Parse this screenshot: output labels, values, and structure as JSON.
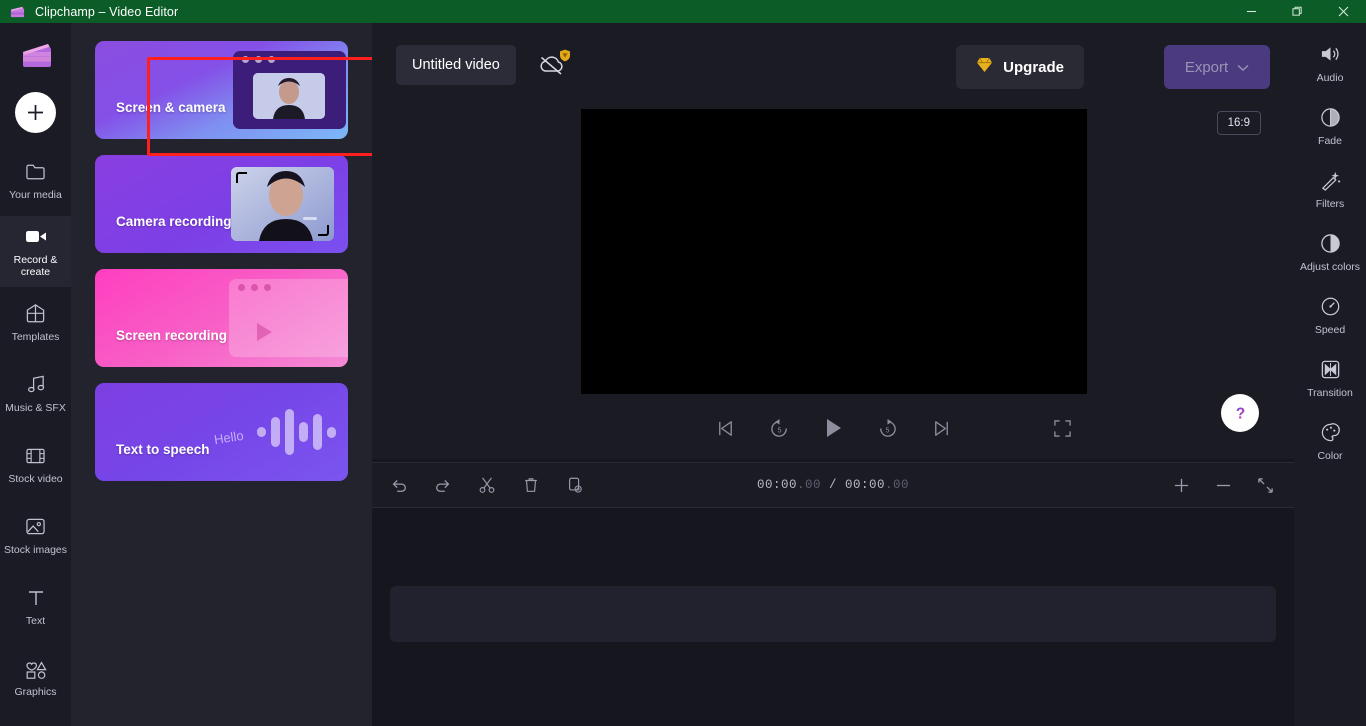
{
  "window": {
    "app_title": "Clipchamp – Video Editor",
    "logo_icon": "clapperboard-icon",
    "controls": [
      {
        "name": "minimize",
        "icon": "minimize-icon"
      },
      {
        "name": "maximize",
        "icon": "restore-icon"
      },
      {
        "name": "close",
        "icon": "close-icon"
      }
    ],
    "titlebar_color": "#0b5c26"
  },
  "left_rail": {
    "logo_icon": "clipchamp-logo-icon",
    "add_button": {
      "icon": "plus-icon",
      "label": "+"
    },
    "items": [
      {
        "label": "Your media",
        "icon": "folder-icon",
        "active": false
      },
      {
        "label": "Record & create",
        "icon": "video-camera-icon",
        "active": true
      },
      {
        "label": "Templates",
        "icon": "templates-icon",
        "active": false
      },
      {
        "label": "Music & SFX",
        "icon": "music-note-icon",
        "active": false
      },
      {
        "label": "Stock video",
        "icon": "film-strip-icon",
        "active": false
      },
      {
        "label": "Stock images",
        "icon": "image-icon",
        "active": false
      },
      {
        "label": "Text",
        "icon": "text-icon",
        "active": false
      },
      {
        "label": "Graphics",
        "icon": "shapes-icon",
        "active": false
      }
    ]
  },
  "panel": {
    "cards": [
      {
        "label": "Screen & camera",
        "highlighted": true,
        "art": "window-with-pip"
      },
      {
        "label": "Camera recording",
        "highlighted": false,
        "art": "person-portrait"
      },
      {
        "label": "Screen recording",
        "highlighted": false,
        "art": "window-with-play"
      },
      {
        "label": "Text to speech",
        "highlighted": false,
        "art": "waveform",
        "art_text": "Hello"
      }
    ],
    "highlight_color": "#ff1f1f",
    "collapse_handle_icon": "chevron-left-icon"
  },
  "header": {
    "project_title": "Untitled video",
    "sync_icon": "cloud-off-icon",
    "sync_badge_icon": "diamond-shield-icon",
    "upgrade": {
      "label": "Upgrade",
      "icon": "diamond-icon"
    },
    "export": {
      "label": "Export",
      "icon": "chevron-down-icon",
      "disabled": true
    }
  },
  "preview": {
    "aspect_ratio": "16:9",
    "canvas_color": "#000000",
    "help_button": {
      "icon": "question-mark-icon",
      "label": "?"
    },
    "collapse_handle_icon": "chevron-left-icon",
    "controls": [
      {
        "name": "skip-to-start",
        "icon": "skip-back-icon"
      },
      {
        "name": "rewind-5-seconds",
        "icon": "rewind-5-icon",
        "label": "5"
      },
      {
        "name": "play",
        "icon": "play-icon"
      },
      {
        "name": "forward-5-seconds",
        "icon": "forward-5-icon",
        "label": "5"
      },
      {
        "name": "skip-to-end",
        "icon": "skip-forward-icon"
      }
    ],
    "fullscreen": {
      "name": "fullscreen",
      "icon": "fullscreen-icon"
    }
  },
  "right_rail": {
    "items": [
      {
        "label": "Audio",
        "icon": "speaker-icon"
      },
      {
        "label": "Fade",
        "icon": "fade-icon"
      },
      {
        "label": "Filters",
        "icon": "magic-wand-icon"
      },
      {
        "label": "Adjust colors",
        "icon": "contrast-icon"
      },
      {
        "label": "Speed",
        "icon": "speedometer-icon"
      },
      {
        "label": "Transition",
        "icon": "transition-icon"
      },
      {
        "label": "Color",
        "icon": "palette-icon"
      }
    ]
  },
  "timeline": {
    "tools": [
      {
        "name": "undo",
        "icon": "undo-icon"
      },
      {
        "name": "redo",
        "icon": "redo-icon"
      },
      {
        "name": "split",
        "icon": "scissors-icon"
      },
      {
        "name": "delete",
        "icon": "trash-icon"
      },
      {
        "name": "duplicate",
        "icon": "duplicate-icon"
      }
    ],
    "timecode_current": "00:00",
    "timecode_current_frac": ".00",
    "timecode_separator": " / ",
    "timecode_total": "00:00",
    "timecode_total_frac": ".00",
    "zoom_controls": [
      {
        "name": "zoom-in",
        "icon": "plus-icon"
      },
      {
        "name": "zoom-out",
        "icon": "minus-icon"
      },
      {
        "name": "fit-to-screen",
        "icon": "fit-icon"
      }
    ]
  }
}
